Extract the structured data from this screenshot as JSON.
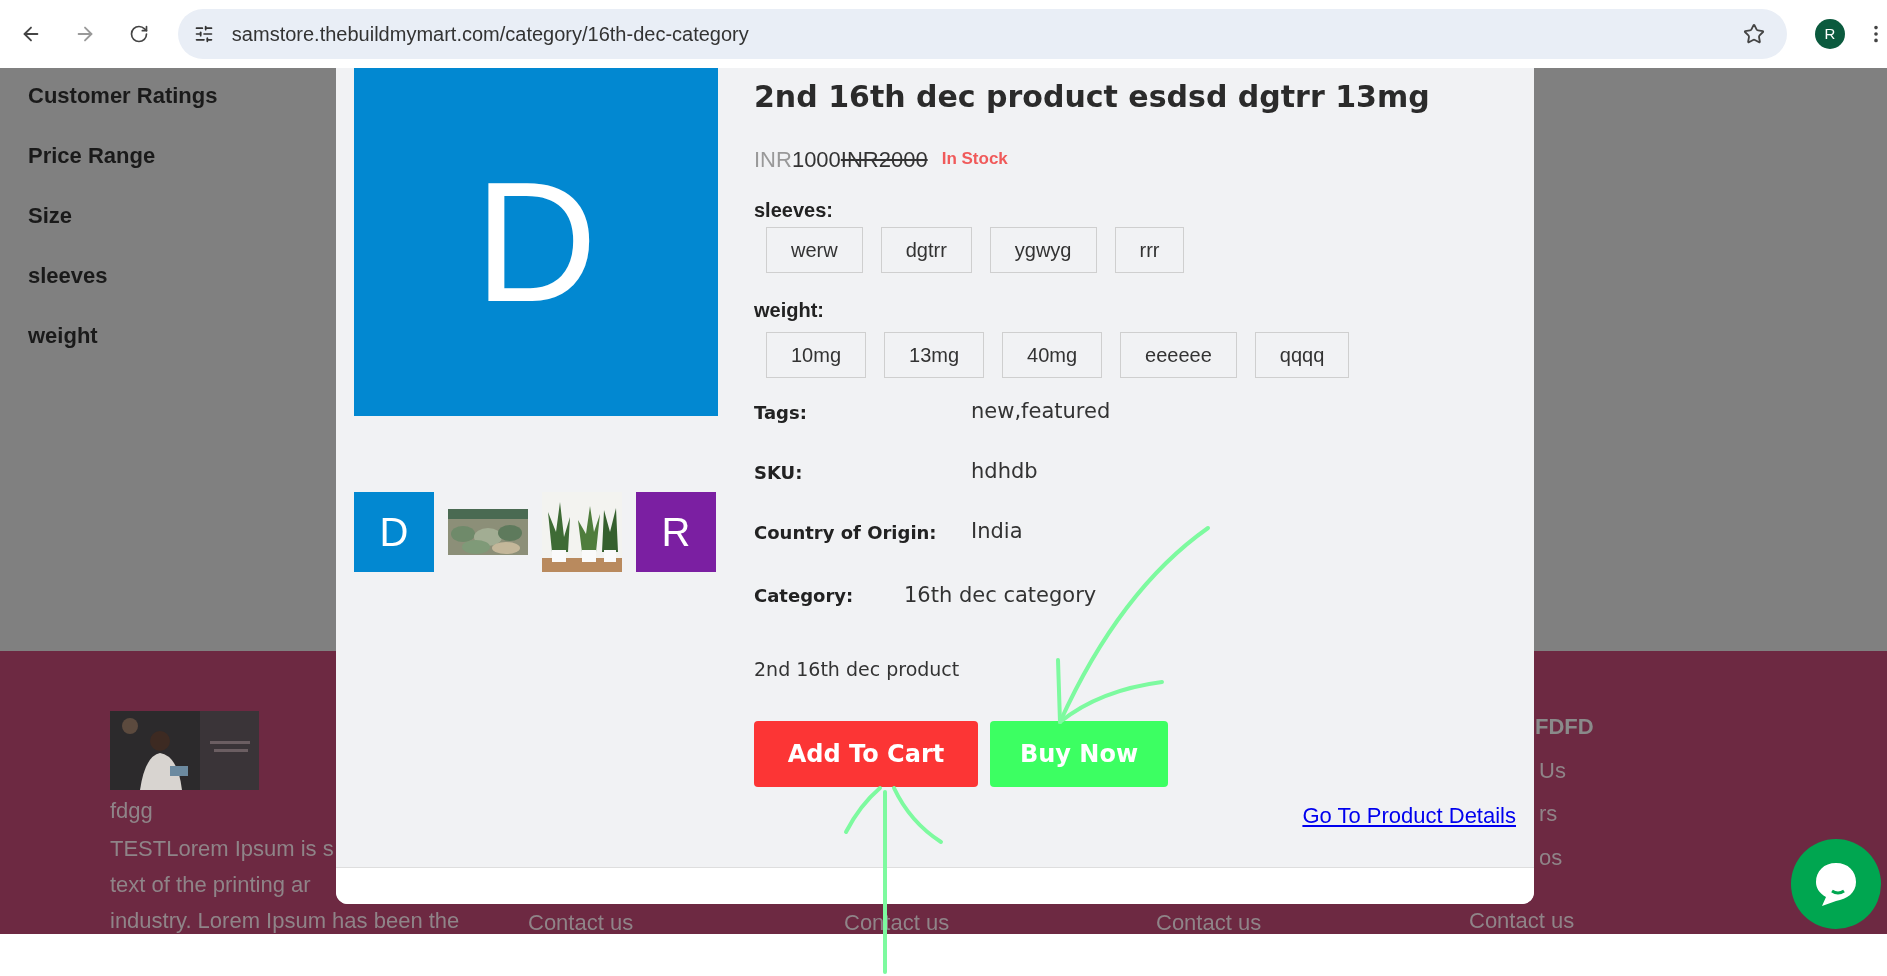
{
  "browser": {
    "url": "samstore.thebuildmymart.com/category/16th-dec-category",
    "profile_initial": "R"
  },
  "sidebar": {
    "filters": [
      "Customer Ratings",
      "Price Range",
      "Size",
      "sleeves",
      "weight"
    ]
  },
  "modal": {
    "main_image": {
      "letter": "D",
      "color": "#0288d1"
    },
    "thumbnails": [
      {
        "kind": "letter",
        "letter": "D",
        "color": "#0288d1"
      },
      {
        "kind": "picture"
      },
      {
        "kind": "picture"
      },
      {
        "kind": "letter",
        "letter": "R",
        "color": "#7b1fa2"
      }
    ],
    "title": "2nd 16th dec product esdsd dgtrr 13mg",
    "price": {
      "currency": "INR",
      "amount": "1000",
      "old_price": "INR2000",
      "stock": "In Stock"
    },
    "options": [
      {
        "label": "sleeves:",
        "values": [
          "werw",
          "dgtrr",
          "ygwyg",
          "rrr"
        ]
      },
      {
        "label": "weight:",
        "values": [
          "10mg",
          "13mg",
          "40mg",
          "eeeeee",
          "qqqq"
        ]
      }
    ],
    "details": [
      {
        "label": "Tags:",
        "value": "new,featured"
      },
      {
        "label": "SKU:",
        "value": "hdhdb"
      },
      {
        "label": "Country of Origin:",
        "value": "India"
      }
    ],
    "category": {
      "label": "Category:",
      "value": "16th dec category"
    },
    "description": "2nd 16th dec product",
    "add_to_cart": "Add To Cart",
    "buy_now": "Buy Now",
    "details_link": "Go To Product Details"
  },
  "footer": {
    "title": "fdgg",
    "text_lines": [
      "TESTLorem Ipsum is s",
      "text of the printing ar",
      "industry. Lorem Ipsum has been the"
    ],
    "contact_links": [
      "Contact us",
      "Contact us",
      "Contact us"
    ],
    "last_column": {
      "heading": "FDFD",
      "links": [
        "Us",
        "rs",
        "os"
      ],
      "contact": "Contact us"
    }
  }
}
